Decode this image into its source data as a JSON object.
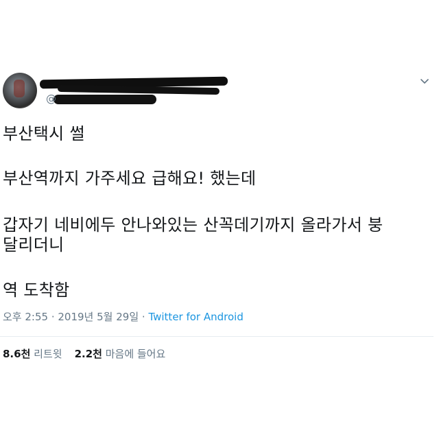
{
  "tweet": {
    "handle_prefix": "@",
    "body_lines": [
      "부산택시 썰",
      "부산역까지 가주세요 급해요!  했는데",
      "갑자기 네비에두 안나와있는 산꼭데기까지 올라가서 붕",
      "달리더니",
      "역 도착함"
    ],
    "meta": {
      "time": "오후 2:55",
      "separator": " · ",
      "date": "2019년 5월 29일",
      "source": "Twitter for Android"
    },
    "stats": {
      "retweets_count": "8.6천",
      "retweets_label": "리트윗",
      "likes_count": "2.2천",
      "likes_label": "마음에 들어요"
    }
  },
  "icons": {
    "menu": "chevron-down-icon"
  },
  "colors": {
    "text": "#14171a",
    "muted": "#657786",
    "link": "#1b95e0",
    "divider": "#e6ecf0"
  }
}
